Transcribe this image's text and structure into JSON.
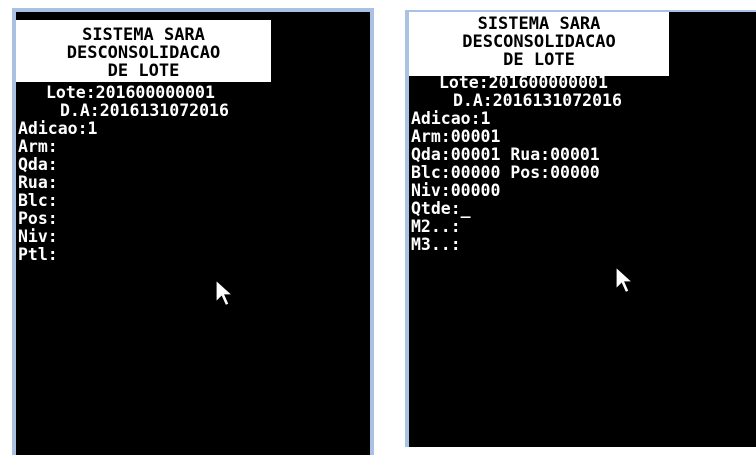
{
  "left_screen": {
    "title_lines": [
      "SISTEMA SARA",
      "DESCONSOLIDACAO",
      "DE LOTE"
    ],
    "header_lines": [
      "Lote:201600000001",
      "D.A:2016131072016"
    ],
    "fields": [
      "Adicao:1",
      "Arm:",
      "Qda:",
      "Rua:",
      "Blc:",
      "Pos:",
      "Niv:",
      "Ptl:"
    ]
  },
  "right_screen": {
    "title_lines": [
      "SISTEMA SARA",
      "DESCONSOLIDACAO",
      "DE LOTE"
    ],
    "header_lines": [
      "Lote:201600000001",
      "D.A:2016131072016"
    ],
    "fields": [
      "Adicao:1",
      "Arm:00001",
      "Qda:00001 Rua:00001",
      "Blc:00000 Pos:00000",
      "Niv:00000",
      "Qtde:_",
      "M2..:",
      "M3..:"
    ]
  },
  "icons": {
    "pointer": "mouse-pointer-icon"
  },
  "colors": {
    "terminal_bg": "#000000",
    "terminal_text": "#ffffff",
    "title_bg": "#ffffff",
    "frame": "#a9c2e3"
  }
}
